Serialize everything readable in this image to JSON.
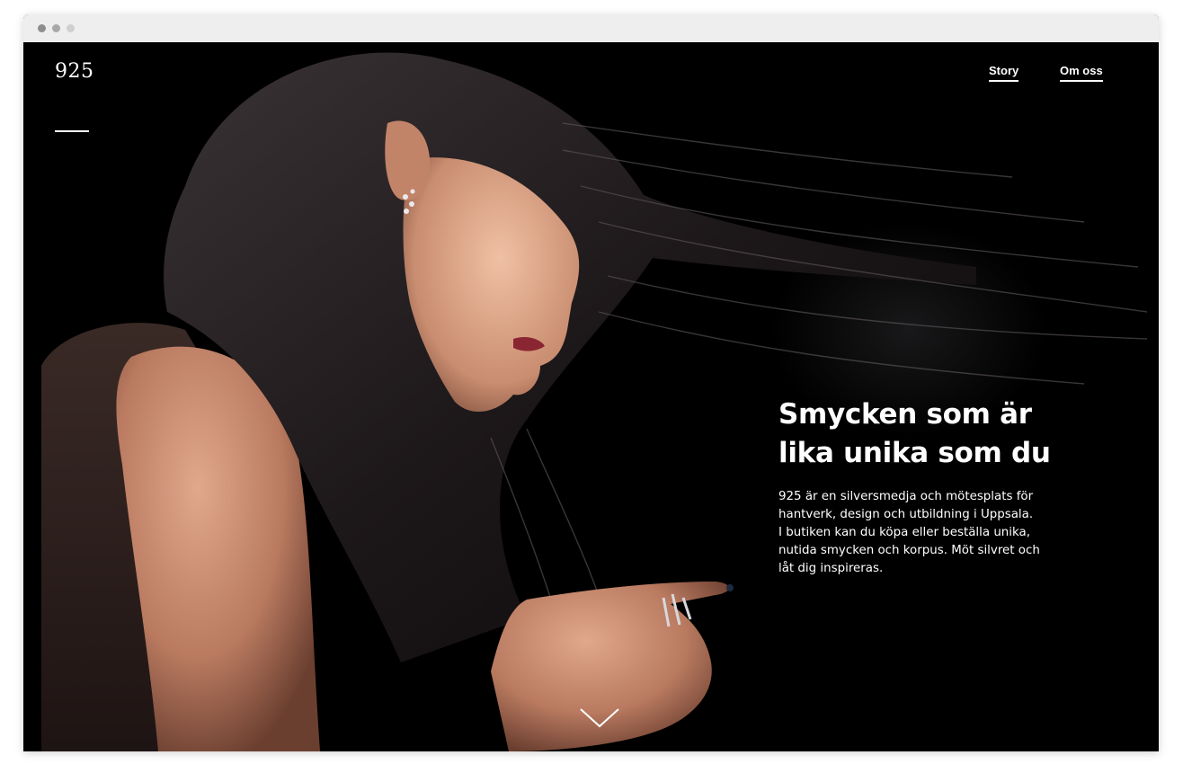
{
  "site": {
    "logo": "925"
  },
  "nav": {
    "items": [
      {
        "label": "Story"
      },
      {
        "label": "Om oss"
      }
    ]
  },
  "hero": {
    "title_line1": "Smycken som är",
    "title_line2": "lika unika som du",
    "text_line1": "925 är en silversmedja och mötesplats för",
    "text_line2": "hantverk, design och utbildning i Uppsala.",
    "text_line3": "I butiken kan du köpa eller beställa unika,",
    "text_line4": "nutida smycken och korpus. Möt silvret och",
    "text_line5": "låt dig inspireras.",
    "image": "woman-with-flowing-hair-wearing-silver-earring-and-rings",
    "scroll_icon": "chevron-down-icon"
  },
  "colors": {
    "background": "#000000",
    "text": "#ffffff",
    "browser_chrome": "#eeeeef"
  }
}
